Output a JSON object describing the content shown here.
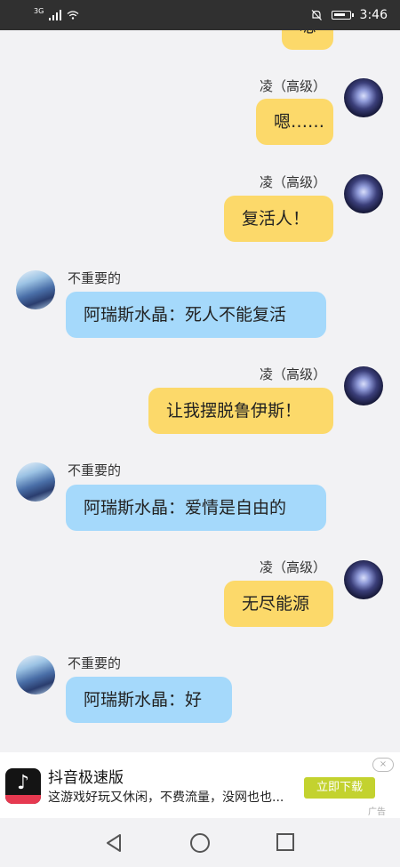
{
  "status_bar": {
    "network": "3G",
    "time": "3:46"
  },
  "chat": {
    "partial_bubble_text": "嗯",
    "messages": [
      {
        "sender": "凌（高级）",
        "side": "self",
        "text": "嗯……"
      },
      {
        "sender": "凌（高级）",
        "side": "self",
        "text": "复活人！"
      },
      {
        "sender": "不重要的",
        "side": "other",
        "text": "阿瑞斯水晶：死人不能复活"
      },
      {
        "sender": "凌（高级）",
        "side": "self",
        "text": "让我摆脱鲁伊斯！"
      },
      {
        "sender": "不重要的",
        "side": "other",
        "text": "阿瑞斯水晶：爱情是自由的"
      },
      {
        "sender": "凌（高级）",
        "side": "self",
        "text": "无尽能源"
      },
      {
        "sender": "不重要的",
        "side": "other",
        "text": "阿瑞斯水晶：好"
      }
    ]
  },
  "ad": {
    "app_icon": "douyin-app-icon",
    "title": "抖音极速版",
    "description": "这游戏好玩又休闲，不费流量，没网也也...",
    "button_label": "立即下载",
    "close_label": "×",
    "ad_label": "广告",
    "button_color": "#c3d22f"
  },
  "nav_bar": {
    "icons": [
      "back-icon",
      "home-icon",
      "recent-apps-icon"
    ]
  },
  "colors": {
    "self_bubble": "#fcd96a",
    "other_bubble": "#a5d9fb"
  }
}
